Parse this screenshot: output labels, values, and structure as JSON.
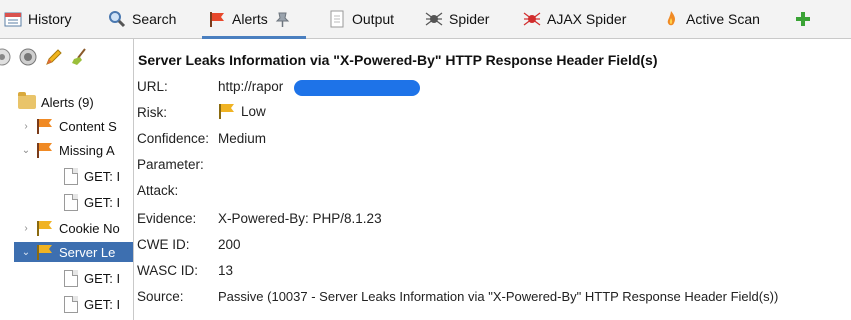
{
  "tabs": [
    {
      "label": "History",
      "icon": "history-icon"
    },
    {
      "label": "Search",
      "icon": "search-icon"
    },
    {
      "label": "Alerts",
      "icon": "alert-flag-icon",
      "active": true
    },
    {
      "label": "Output",
      "icon": "output-icon"
    },
    {
      "label": "Spider",
      "icon": "spider-icon"
    },
    {
      "label": "AJAX Spider",
      "icon": "ajax-spider-icon"
    },
    {
      "label": "Active Scan",
      "icon": "active-scan-icon"
    }
  ],
  "colors": {
    "accent": "#4a7fbf",
    "selection": "#3d6fb0",
    "flag_red": "#e8482b",
    "flag_yellow": "#f0b323",
    "redaction": "#1e73e8"
  },
  "tree": {
    "root": "Alerts (9)",
    "items": [
      "Content S",
      "Missing A",
      "GET: I",
      "GET: I",
      "Cookie No",
      "Server Le",
      "GET: I",
      "GET: I"
    ]
  },
  "alert": {
    "title": "Server Leaks Information via \"X-Powered-By\" HTTP Response Header Field(s)",
    "labels": {
      "url": "URL:",
      "risk": "Risk:",
      "confidence": "Confidence:",
      "parameter": "Parameter:",
      "attack": "Attack:",
      "evidence": "Evidence:",
      "cwe": "CWE ID:",
      "wasc": "WASC ID:",
      "source": "Source:"
    },
    "values": {
      "url": "http://rapor",
      "risk": "Low",
      "confidence": "Medium",
      "parameter": "",
      "attack": "",
      "evidence": "X-Powered-By: PHP/8.1.23",
      "cwe": "200",
      "wasc": "13",
      "source": "Passive (10037 - Server Leaks Information via \"X-Powered-By\" HTTP Response Header Field(s))"
    }
  }
}
